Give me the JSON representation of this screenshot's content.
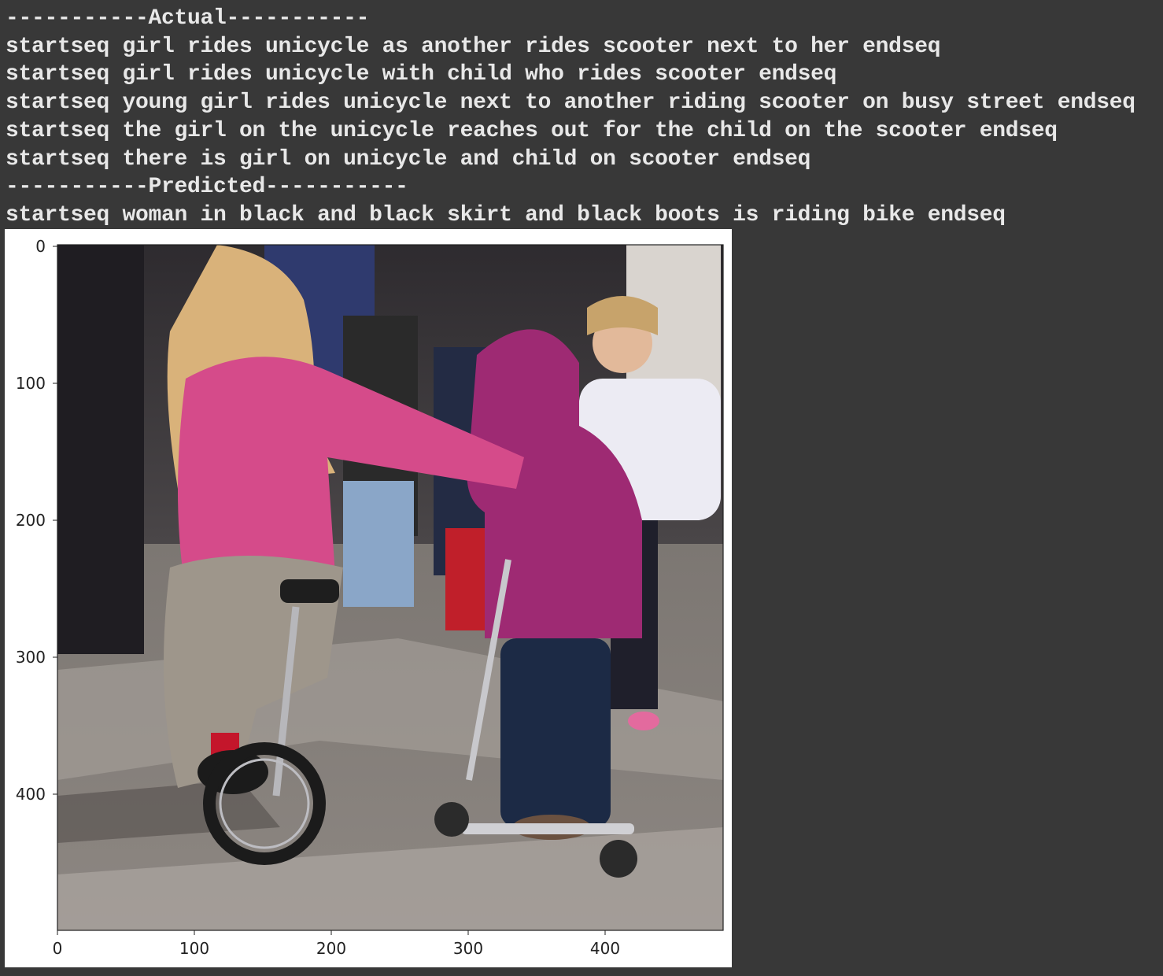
{
  "console": {
    "actual_header": "-----------Actual-----------",
    "actual_captions": [
      "startseq girl rides unicycle as another rides scooter next to her endseq",
      "startseq girl rides unicycle with child who rides scooter endseq",
      "startseq young girl rides unicycle next to another riding scooter on busy street endseq",
      "startseq the girl on the unicycle reaches out for the child on the scooter endseq",
      "startseq there is girl on unicycle and child on scooter endseq"
    ],
    "predicted_header": "-----------Predicted-----------",
    "predicted_caption": "startseq woman in black and black skirt and black boots is riding bike endseq"
  },
  "figure": {
    "x_ticks": [
      "0",
      "100",
      "200",
      "300",
      "400"
    ],
    "y_ticks": [
      "0",
      "100",
      "200",
      "300",
      "400"
    ],
    "image_description": "photo of a girl in a pink hoodie riding a unicycle beside a child in a magenta hoodie on a scooter, crowd in background"
  },
  "colors": {
    "background": "#383838",
    "text": "#e8e8e8",
    "figure_background": "#ffffff"
  }
}
